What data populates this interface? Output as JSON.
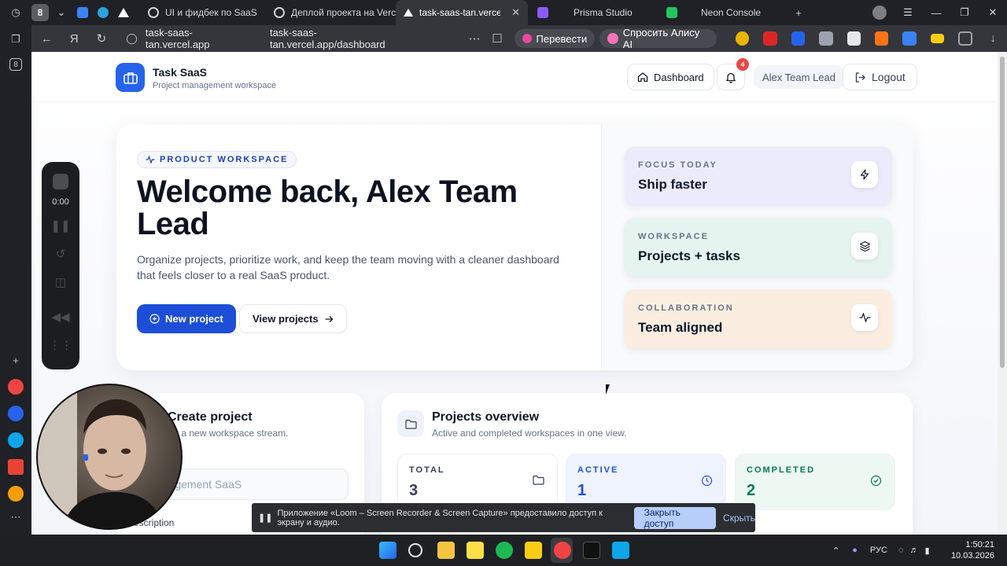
{
  "browser": {
    "tab_count": "8",
    "tabs": [
      {
        "label": "UI и фидбек по SaaS"
      },
      {
        "label": "Деплой проекта на Verce"
      },
      {
        "label": "task-saas-tan.vercel.ap"
      },
      {
        "label": "Prisma Studio"
      },
      {
        "label": "Neon Console"
      }
    ],
    "address": {
      "host": "task-saas-tan.vercel.app",
      "path": "task-saas-tan.vercel.app/dashboard"
    },
    "translate_label": "Перевести",
    "alice_label": "Спросить Алису AI",
    "sidebar_count": "8"
  },
  "app": {
    "brand_title": "Task SaaS",
    "brand_subtitle": "Project management workspace",
    "nav": {
      "dashboard_label": "Dashboard",
      "notification_count": "4",
      "user_label": "Alex Team Lead",
      "logout_label": "Logout"
    },
    "hero": {
      "tag": "PRODUCT WORKSPACE",
      "title": "Welcome back, Alex Team Lead",
      "description": "Organize projects, prioritize work, and keep the team moving with a cleaner dashboard that feels closer to a real SaaS product.",
      "new_project_label": "New project",
      "view_projects_label": "View projects"
    },
    "focus_cards": [
      {
        "label": "FOCUS TODAY",
        "value": "Ship faster",
        "icon": "bolt-icon",
        "color": "#ecebfb"
      },
      {
        "label": "WORKSPACE",
        "value": "Projects + tasks",
        "icon": "layers-icon",
        "color": "#e5f4ee"
      },
      {
        "label": "COLLABORATION",
        "value": "Team aligned",
        "icon": "activity-icon",
        "color": "#fbeee0"
      }
    ],
    "create": {
      "title": "Create project",
      "subtitle": "art a new workspace stream.",
      "field_label": "e",
      "field_value": "anagement SaaS",
      "description_label": "escription"
    },
    "overview": {
      "title": "Projects overview",
      "subtitle": "Active and completed workspaces in one view.",
      "stats": [
        {
          "label": "TOTAL",
          "value": "3",
          "color": "#334155"
        },
        {
          "label": "ACTIVE",
          "value": "1",
          "color": "#1d4ed8"
        },
        {
          "label": "COMPLETED",
          "value": "2",
          "color": "#047857"
        }
      ]
    }
  },
  "recorder": {
    "time": "0:00"
  },
  "notice": {
    "text": "Приложение «Loom – Screen Recorder & Screen Capture» предоставило доступ к экрану и аудио.",
    "close_access_label": "Закрыть доступ",
    "hide_label": "Скрыть"
  },
  "taskbar": {
    "lang": "РУС",
    "time": "1:50:21",
    "date": "10.03.2026"
  },
  "colors": {
    "accent": "#1d4ed8",
    "danger": "#ef4444"
  }
}
